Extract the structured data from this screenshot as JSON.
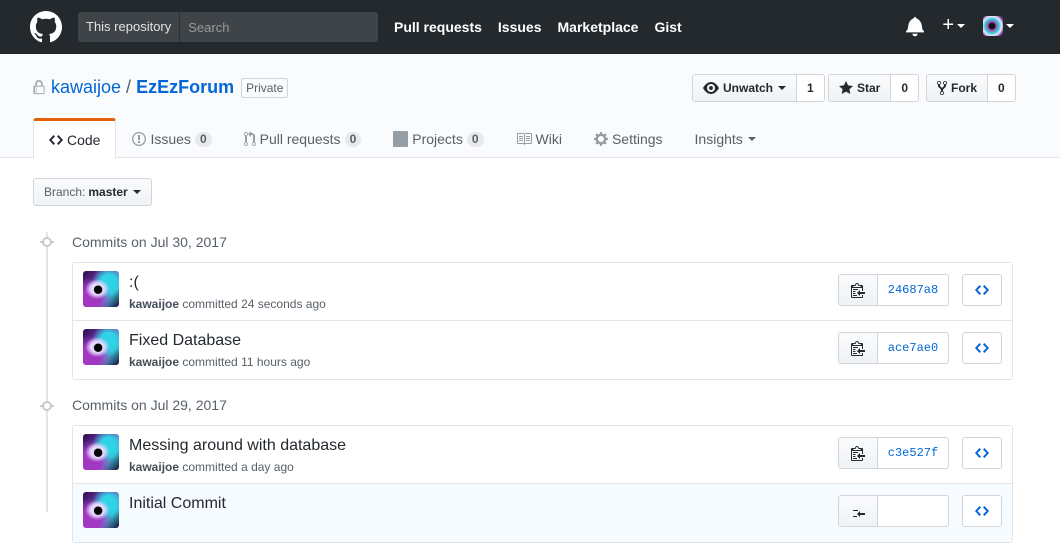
{
  "header": {
    "search_scope": "This repository",
    "search_placeholder": "Search",
    "nav": [
      "Pull requests",
      "Issues",
      "Marketplace",
      "Gist"
    ],
    "plus": "+"
  },
  "repo": {
    "owner": "kawaijoe",
    "separator": "/",
    "name": "EzEzForum",
    "visibility": "Private",
    "watch": {
      "label": "Unwatch",
      "count": "1"
    },
    "star": {
      "label": "Star",
      "count": "0"
    },
    "fork": {
      "label": "Fork",
      "count": "0"
    }
  },
  "tabs": [
    {
      "label": "Code",
      "icon": "code-icon",
      "selected": true
    },
    {
      "label": "Issues",
      "counter": "0",
      "icon": "issue-icon"
    },
    {
      "label": "Pull requests",
      "counter": "0",
      "icon": "git-pull-request-icon"
    },
    {
      "label": "Projects",
      "counter": "0",
      "icon": "project-icon"
    },
    {
      "label": "Wiki",
      "icon": "book-icon"
    },
    {
      "label": "Settings",
      "icon": "gear-icon"
    },
    {
      "label": "Insights",
      "icon": "chevron-down-icon"
    }
  ],
  "branch": {
    "prefix": "Branch:",
    "name": "master"
  },
  "commit_groups": [
    {
      "title": "Commits on Jul 30, 2017",
      "commits": [
        {
          "message": ":(",
          "author": "kawaijoe",
          "verb": "committed",
          "time": "24 seconds ago",
          "sha": "24687a8"
        },
        {
          "message": "Fixed Database",
          "author": "kawaijoe",
          "verb": "committed",
          "time": "11 hours ago",
          "sha": "ace7ae0"
        }
      ]
    },
    {
      "title": "Commits on Jul 29, 2017",
      "commits": [
        {
          "message": "Messing around with database",
          "author": "kawaijoe",
          "verb": "committed",
          "time": "a day ago",
          "sha": "c3e527f"
        },
        {
          "message": "Initial Commit",
          "author": "kawaijoe",
          "verb": "committed",
          "time": "",
          "sha": ""
        }
      ]
    }
  ],
  "colors": {
    "header_bg": "#24292e",
    "link": "#0366d6",
    "tab_accent": "#e36209"
  }
}
